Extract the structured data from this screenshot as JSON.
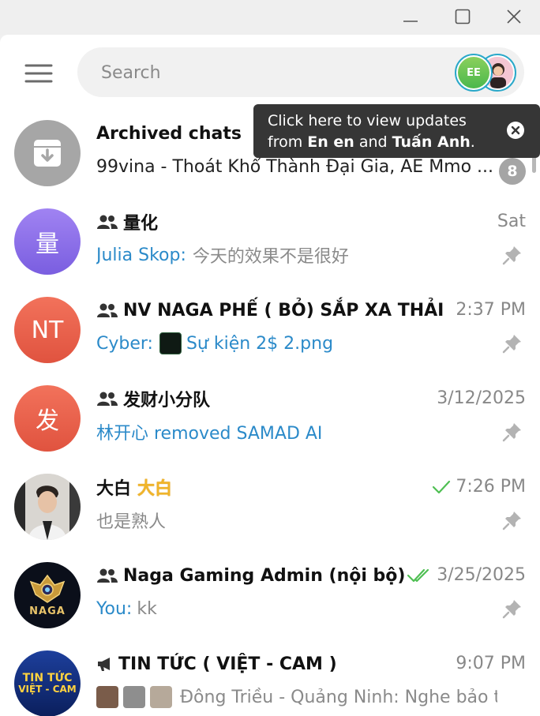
{
  "window": {
    "minimize_icon": "minimize-icon",
    "maximize_icon": "maximize-icon",
    "close_icon": "close-icon"
  },
  "search": {
    "placeholder": "Search"
  },
  "stories": [
    {
      "initials": "EE",
      "color": "#6cc24a"
    },
    {
      "name": "Tuấn Anh"
    }
  ],
  "tooltip": {
    "line1": "Click here to view updates",
    "from": "from",
    "name1": "En en",
    "and": "and",
    "name2": "Tuấn Anh",
    "period": "."
  },
  "chats": [
    {
      "title": "Archived chats",
      "preview_a": "99vina - Thoát Khổ Thành Đại Gia",
      "preview_b": ", AE Mmo ...",
      "badge": "8"
    },
    {
      "avatar_text": "量",
      "avatar_color": "#8b6ee8",
      "title": "量化",
      "time": "Sat",
      "sender": "Julia Skop:",
      "preview": "今天的效果不是很好"
    },
    {
      "avatar_text": "NT",
      "avatar_color": "#e8604a",
      "title": "NV NAGA PHẾ ( BỎ) SẮP XA THẢI",
      "time": "2:37 PM",
      "sender": "Cyber:",
      "preview": "Sự kiện 2$ 2.png"
    },
    {
      "avatar_text": "发",
      "avatar_color": "#e8604a",
      "title": "发财小分队",
      "time": "3/12/2025",
      "preview": "林开心 removed SAMAD AI"
    },
    {
      "title": "大白",
      "title_badge": "大白",
      "time": "7:26 PM",
      "preview": "也是熟人"
    },
    {
      "avatar_text": "NAGA",
      "title": "Naga Gaming Admin (nội bộ)",
      "time": "3/25/2025",
      "sender": "You:",
      "preview": "kk"
    },
    {
      "avatar_text_1": "TIN TỨC",
      "avatar_text_2": "VIỆT - CAM",
      "title": "TIN TỨC ( VIỆT - CAM )",
      "time": "9:07 PM",
      "preview": "Đông Triều  - Quảng Ninh: Nghe bảo tiể..."
    }
  ],
  "colors": {
    "accent": "#2b8ac9",
    "check_green": "#4fbf53",
    "story_ring": "#2aa8c9",
    "tooltip_bg": "#363636"
  }
}
